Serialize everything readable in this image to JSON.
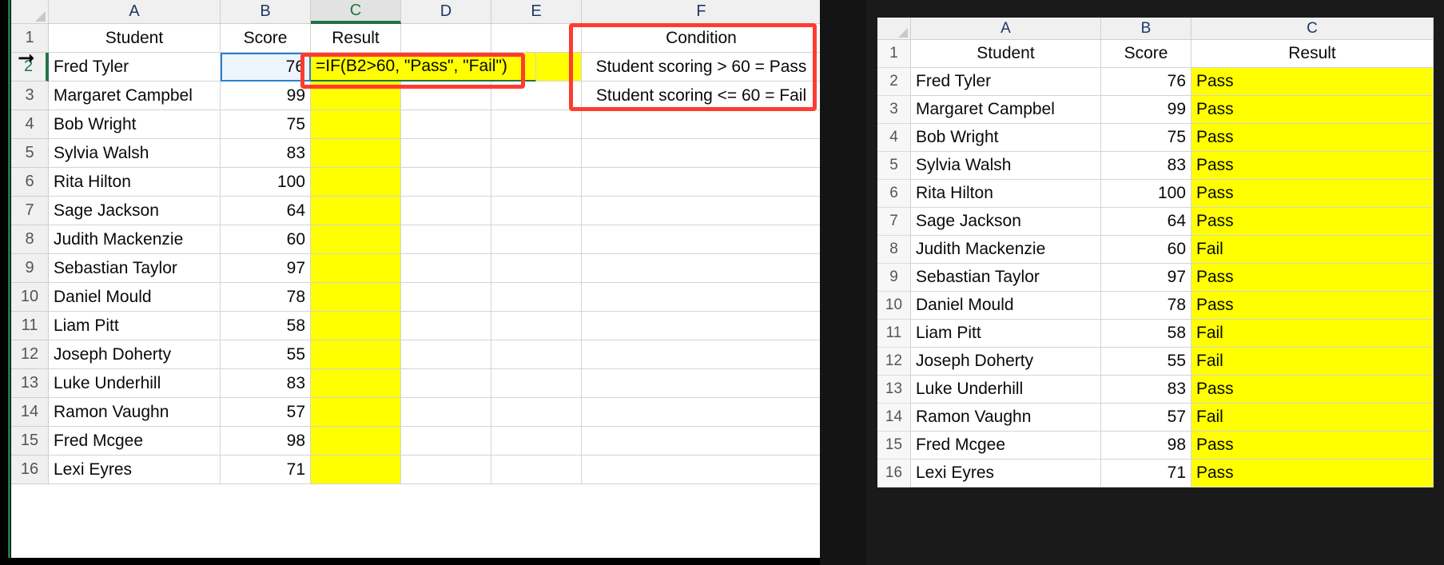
{
  "left_sheet": {
    "column_headers": [
      "A",
      "B",
      "C",
      "D",
      "E",
      "F"
    ],
    "active_column": "C",
    "active_row": "2",
    "row_numbers": [
      "1",
      "2",
      "3",
      "4",
      "5",
      "6",
      "7",
      "8",
      "9",
      "10",
      "11",
      "12",
      "13",
      "14",
      "15",
      "16"
    ],
    "headers": {
      "student": "Student",
      "score": "Score",
      "result": "Result"
    },
    "rows": [
      {
        "row": "2",
        "student": "Fred Tyler",
        "score": "76"
      },
      {
        "row": "3",
        "student": "Margaret Campbel",
        "score": "99"
      },
      {
        "row": "4",
        "student": "Bob Wright",
        "score": "75"
      },
      {
        "row": "5",
        "student": "Sylvia Walsh",
        "score": "83"
      },
      {
        "row": "6",
        "student": "Rita Hilton",
        "score": "100"
      },
      {
        "row": "7",
        "student": "Sage Jackson",
        "score": "64"
      },
      {
        "row": "8",
        "student": "Judith Mackenzie",
        "score": "60"
      },
      {
        "row": "9",
        "student": "Sebastian Taylor",
        "score": "97"
      },
      {
        "row": "10",
        "student": "Daniel Mould",
        "score": "78"
      },
      {
        "row": "11",
        "student": "Liam Pitt",
        "score": "58"
      },
      {
        "row": "12",
        "student": "Joseph Doherty",
        "score": "55"
      },
      {
        "row": "13",
        "student": "Luke Underhill",
        "score": "83"
      },
      {
        "row": "14",
        "student": "Ramon Vaughn",
        "score": "57"
      },
      {
        "row": "15",
        "student": "Fred Mcgee",
        "score": "98"
      },
      {
        "row": "16",
        "student": "Lexi Eyres",
        "score": "71"
      }
    ],
    "formula_cell": {
      "address": "C2",
      "text": "=IF(B2>60, \"Pass\", \"Fail\")",
      "state": "editing"
    },
    "condition_panel": {
      "header": "Condition",
      "line1": "Student scoring > 60 = Pass",
      "line2": "Student scoring <= 60 = Fail"
    }
  },
  "right_sheet": {
    "column_headers": [
      "A",
      "B",
      "C"
    ],
    "row_numbers": [
      "1",
      "2",
      "3",
      "4",
      "5",
      "6",
      "7",
      "8",
      "9",
      "10",
      "11",
      "12",
      "13",
      "14",
      "15",
      "16"
    ],
    "headers": {
      "student": "Student",
      "score": "Score",
      "result": "Result"
    },
    "rows": [
      {
        "row": "2",
        "student": "Fred Tyler",
        "score": "76",
        "result": "Pass"
      },
      {
        "row": "3",
        "student": "Margaret Campbel",
        "score": "99",
        "result": "Pass"
      },
      {
        "row": "4",
        "student": "Bob Wright",
        "score": "75",
        "result": "Pass"
      },
      {
        "row": "5",
        "student": "Sylvia Walsh",
        "score": "83",
        "result": "Pass"
      },
      {
        "row": "6",
        "student": "Rita Hilton",
        "score": "100",
        "result": "Pass"
      },
      {
        "row": "7",
        "student": "Sage Jackson",
        "score": "64",
        "result": "Pass"
      },
      {
        "row": "8",
        "student": "Judith Mackenzie",
        "score": "60",
        "result": "Fail"
      },
      {
        "row": "9",
        "student": "Sebastian Taylor",
        "score": "97",
        "result": "Pass"
      },
      {
        "row": "10",
        "student": "Daniel Mould",
        "score": "78",
        "result": "Pass"
      },
      {
        "row": "11",
        "student": "Liam Pitt",
        "score": "58",
        "result": "Fail"
      },
      {
        "row": "12",
        "student": "Joseph Doherty",
        "score": "55",
        "result": "Fail"
      },
      {
        "row": "13",
        "student": "Luke Underhill",
        "score": "83",
        "result": "Pass"
      },
      {
        "row": "14",
        "student": "Ramon Vaughn",
        "score": "57",
        "result": "Fail"
      },
      {
        "row": "15",
        "student": "Fred Mcgee",
        "score": "98",
        "result": "Pass"
      },
      {
        "row": "16",
        "student": "Lexi Eyres",
        "score": "71",
        "result": "Pass"
      }
    ]
  },
  "colors": {
    "highlight_yellow": "#ffff00",
    "annotation_red": "#ff3b30",
    "excel_green": "#217346",
    "selection_blue": "#2a7fd4"
  }
}
